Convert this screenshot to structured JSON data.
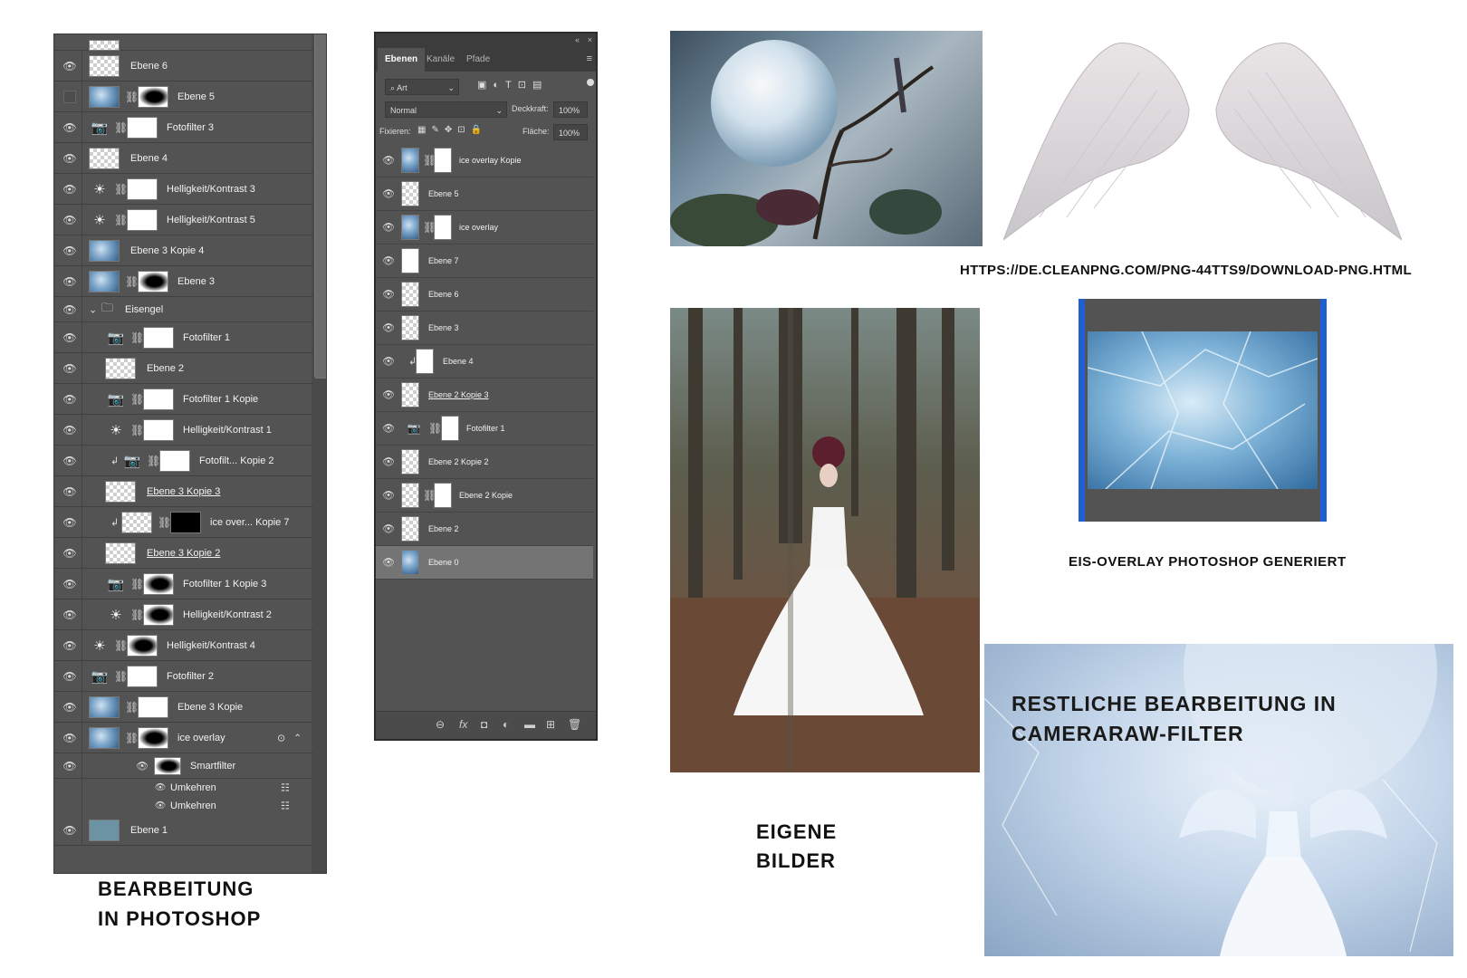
{
  "layers_panel_1": {
    "rows": [
      {
        "name": "Ebene 6"
      },
      {
        "name": "Ebene 5"
      },
      {
        "name": "Fotofilter 3"
      },
      {
        "name": "Ebene 4"
      },
      {
        "name": "Helligkeit/Kontrast 3"
      },
      {
        "name": "Helligkeit/Kontrast 5"
      },
      {
        "name": "Ebene 3 Kopie 4"
      },
      {
        "name": "Ebene 3"
      },
      {
        "name": "Eisengel"
      },
      {
        "name": "Fotofilter 1"
      },
      {
        "name": "Ebene 2"
      },
      {
        "name": "Fotofilter 1 Kopie"
      },
      {
        "name": "Helligkeit/Kontrast 1"
      },
      {
        "name": "Fotofilt... Kopie 2"
      },
      {
        "name": "Ebene 3 Kopie 3"
      },
      {
        "name": "ice over... Kopie 7"
      },
      {
        "name": "Ebene 3 Kopie 2"
      },
      {
        "name": "Fotofilter 1 Kopie 3"
      },
      {
        "name": "Helligkeit/Kontrast 2"
      },
      {
        "name": "Helligkeit/Kontrast 4"
      },
      {
        "name": "Fotofilter 2"
      },
      {
        "name": "Ebene 3 Kopie"
      },
      {
        "name": "ice overlay"
      },
      {
        "name": "Smartfilter"
      },
      {
        "name": "Umkehren"
      },
      {
        "name": "Umkehren"
      },
      {
        "name": "Ebene 1"
      }
    ]
  },
  "layers_panel_2": {
    "tabs": [
      "Ebenen",
      "Kanäle",
      "Pfade"
    ],
    "filter_kind": "Art",
    "blend_mode": "Normal",
    "opacity_label": "Deckkraft:",
    "opacity_value": "100%",
    "lock_label": "Fixieren:",
    "fill_label": "Fläche:",
    "fill_value": "100%",
    "rows": [
      {
        "name": "ice overlay Kopie"
      },
      {
        "name": "Ebene 5"
      },
      {
        "name": "ice overlay"
      },
      {
        "name": "Ebene 7"
      },
      {
        "name": "Ebene 6"
      },
      {
        "name": "Ebene 3"
      },
      {
        "name": "Ebene 4"
      },
      {
        "name": "Ebene 2 Kopie 3"
      },
      {
        "name": "Fotofilter 1"
      },
      {
        "name": "Ebene 2 Kopie 2"
      },
      {
        "name": "Ebene 2 Kopie"
      },
      {
        "name": "Ebene 2"
      },
      {
        "name": "Ebene 0"
      }
    ]
  },
  "captions": {
    "photoshop_line1": "BEARBEITUNG",
    "photoshop_line2": "IN PHOTOSHOP",
    "own_line1": "EIGENE",
    "own_line2": "BILDER",
    "url": "HTTPS://DE.CLEANPNG.COM/PNG-44TTS9/DOWNLOAD-PNG.HTML",
    "overlay": "EIS-OVERLAY PHOTOSHOP GENERIERT",
    "camera_line1": "RESTLICHE BEARBEITUNG IN",
    "camera_line2": "CAMERARAW-FILTER"
  },
  "colors": {
    "panel_bg": "#535353",
    "accent_blue": "#1f5fd1"
  }
}
